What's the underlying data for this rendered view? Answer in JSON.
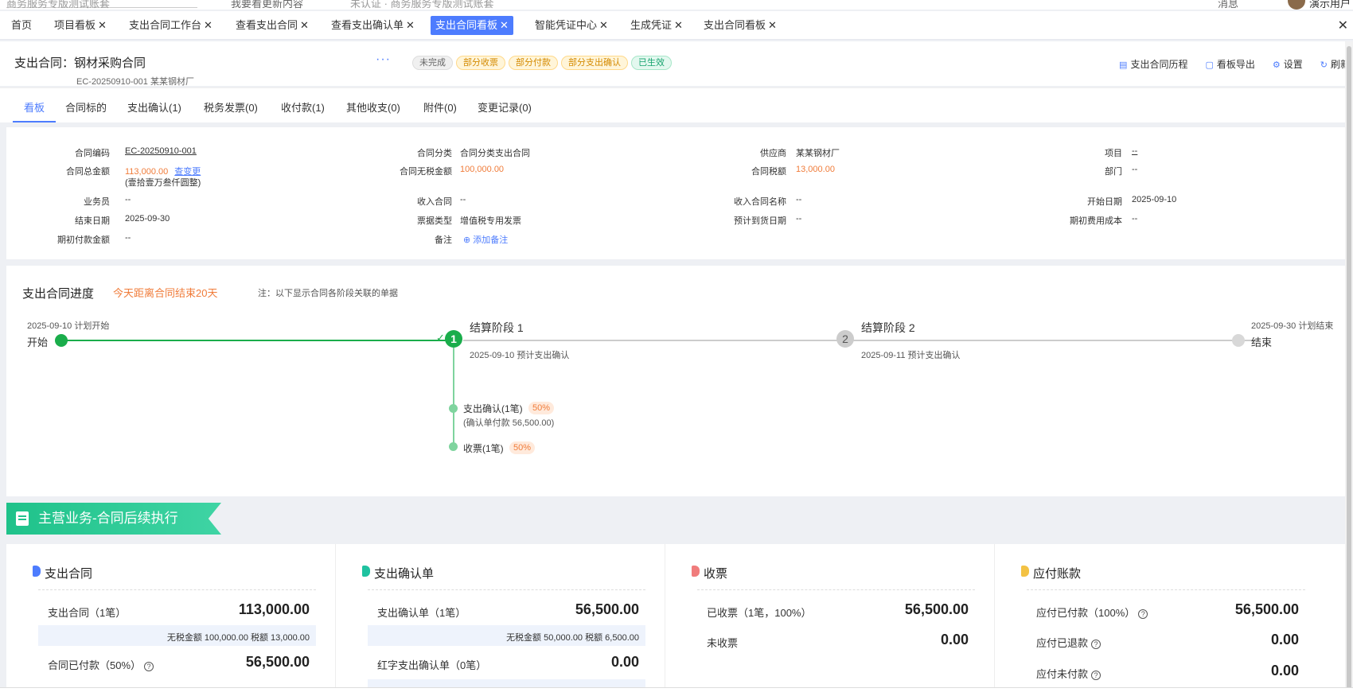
{
  "topbar": {
    "search_hint": "商务服务专版测试账套",
    "item1": "我要看更新内容",
    "item2": "未认证 · 商务服务专版测试账套",
    "item3": "消息",
    "user": "演示用户"
  },
  "tabs": [
    {
      "label": "首页",
      "closable": false
    },
    {
      "label": "项目看板",
      "closable": true
    },
    {
      "label": "支出合同工作台",
      "closable": true
    },
    {
      "label": "查看支出合同",
      "closable": true
    },
    {
      "label": "查看支出确认单",
      "closable": true
    },
    {
      "label": "支出合同看板",
      "closable": true,
      "active": true
    },
    {
      "label": "智能凭证中心",
      "closable": true
    },
    {
      "label": "生成凭证",
      "closable": true
    },
    {
      "label": "支出合同看板",
      "closable": true
    }
  ],
  "header": {
    "prefix": "支出合同：",
    "name": "钢材采购合同",
    "more": "···",
    "sub": "EC-20250910-001   某某钢材厂",
    "badges": [
      {
        "label": "未完成",
        "style": "gray"
      },
      {
        "label": "部分收票",
        "style": "yellow"
      },
      {
        "label": "部分付款",
        "style": "yellow"
      },
      {
        "label": "部分支出确认",
        "style": "yellow"
      },
      {
        "label": "已生效",
        "style": "green"
      }
    ],
    "actions": [
      {
        "label": "支出合同历程",
        "icon": "history-icon"
      },
      {
        "label": "看板导出",
        "icon": "export-icon"
      },
      {
        "label": "设置",
        "icon": "gear-icon"
      },
      {
        "label": "刷新",
        "icon": "refresh-icon"
      }
    ]
  },
  "subtabs": [
    "看板",
    "合同标的",
    "支出确认(1)",
    "税务发票(0)",
    "收付款(1)",
    "其他收支(0)",
    "附件(0)",
    "变更记录(0)"
  ],
  "info": {
    "contract_code_label": "合同编码",
    "contract_code": "EC-20250910-001",
    "category_label": "合同分类",
    "category": "合同分类支出合同",
    "supplier_label": "供应商",
    "supplier": "某某钢材厂",
    "project_label": "项目",
    "project": "--",
    "total_label": "合同总金额",
    "total": "113,000.00",
    "total_change": "查变更",
    "total_words": "(壹拾壹万叁仟圆整)",
    "notax_label": "合同无税金额",
    "notax": "100,000.00",
    "tax_label": "合同税额",
    "tax": "13,000.00",
    "dept_label": "部门",
    "dept": "--",
    "salesman_label": "业务员",
    "salesman": "--",
    "income_label": "收入合同",
    "income": "--",
    "income_name_label": "收入合同名称",
    "income_name": "--",
    "start_label": "开始日期",
    "start": "2025-09-10",
    "end_label": "结束日期",
    "end": "2025-09-30",
    "invoice_type_label": "票据类型",
    "invoice_type": "增值税专用发票",
    "arrival_label": "预计到货日期",
    "arrival": "--",
    "initial_cost_label": "期初费用成本",
    "initial_cost": "--",
    "initial_pay_label": "期初付款金额",
    "initial_pay": "--",
    "remark_label": "备注",
    "remark_add": "添加备注"
  },
  "progress": {
    "title": "支出合同进度",
    "remaining": "今天距离合同结束20天",
    "note": "注：以下显示合同各阶段关联的单据",
    "start_date": "2025-09-10 计划开始",
    "start_label": "开始",
    "end_date": "2025-09-30 计划结束",
    "end_label": "结束",
    "stage1": {
      "num": "1",
      "name": "结算阶段 1",
      "desc": "2025-09-10 预计支出确认"
    },
    "stage2": {
      "num": "2",
      "name": "结算阶段 2",
      "desc": "2025-09-11 预计支出确认"
    },
    "sub1": {
      "label": "支出确认(1笔)",
      "pct": "50%",
      "detail": "(确认单付款 56,500.00)"
    },
    "sub2": {
      "label": "收票(1笔)",
      "pct": "50%"
    },
    "colors": {
      "done": "#1aad4b",
      "pending": "#cccccc"
    }
  },
  "banner": {
    "title": "主营业务-合同后续执行"
  },
  "cards": [
    {
      "title": "支出合同",
      "color": "#4d7cfe",
      "rows": [
        {
          "label": "支出合同（1笔）",
          "value": "113,000.00"
        },
        {
          "sub": "无税金额 100,000.00 税额 13,000.00"
        },
        {
          "label": "合同已付款（50%）",
          "value": "56,500.00",
          "help": true
        }
      ]
    },
    {
      "title": "支出确认单",
      "color": "#1fc2a0",
      "rows": [
        {
          "label": "支出确认单（1笔）",
          "value": "56,500.00"
        },
        {
          "sub": "无税金额 50,000.00 税额 6,500.00"
        },
        {
          "label": "红字支出确认单（0笔）",
          "value": "0.00"
        }
      ]
    },
    {
      "title": "收票",
      "color": "#f07c7c",
      "rows": [
        {
          "label": "已收票（1笔，100%）",
          "value": "56,500.00"
        },
        {
          "label": "未收票",
          "value": "0.00"
        }
      ]
    },
    {
      "title": "应付账款",
      "color": "#f3c244",
      "rows": [
        {
          "label": "应付已付款（100%）",
          "value": "56,500.00",
          "help": true
        },
        {
          "label": "应付已退款",
          "value": "0.00",
          "help": true
        },
        {
          "label": "应付未付款",
          "value": "0.00",
          "help": true
        }
      ]
    }
  ]
}
